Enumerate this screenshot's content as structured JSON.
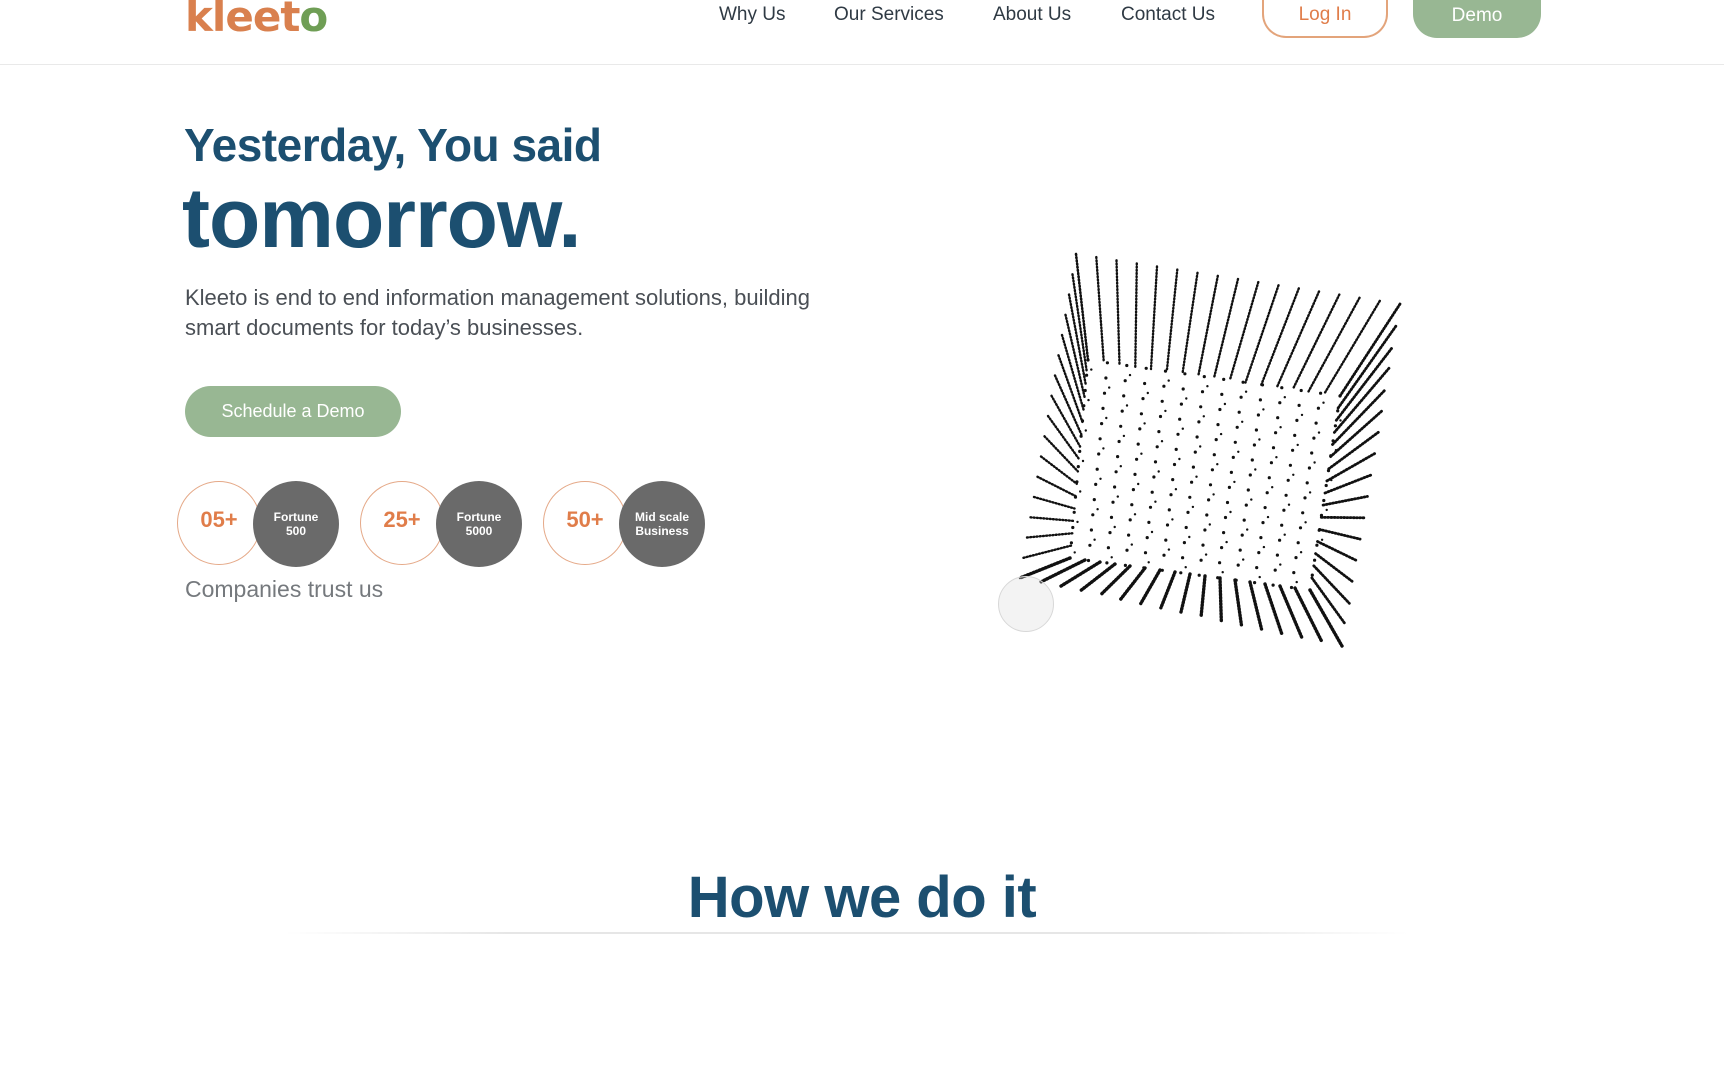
{
  "brand": {
    "logo_text_part1": "kle",
    "logo_text_part2": "e",
    "logo_text_part3": "t",
    "logo_text_part4": "o"
  },
  "nav": {
    "items": [
      "Why Us",
      "Our Services",
      "About Us",
      "Contact Us"
    ],
    "login_label": "Log In",
    "demo_label": "Demo"
  },
  "hero": {
    "line1": "Yesterday, You said",
    "line2": "tomorrow.",
    "description": "Kleeto is end to end information management solutions, building smart documents for today’s businesses.",
    "cta_label": "Schedule a Demo"
  },
  "stats": [
    {
      "number": "05+",
      "label": "Fortune 500"
    },
    {
      "number": "25+",
      "label": "Fortune 5000"
    },
    {
      "number": "50+",
      "label": "Mid scale Business"
    }
  ],
  "trust_text": "Companies trust us",
  "section": {
    "title": "How we do it"
  },
  "colors": {
    "brand_navy": "#1c4f70",
    "accent_orange": "#e07d4a",
    "accent_green": "#98b793"
  }
}
